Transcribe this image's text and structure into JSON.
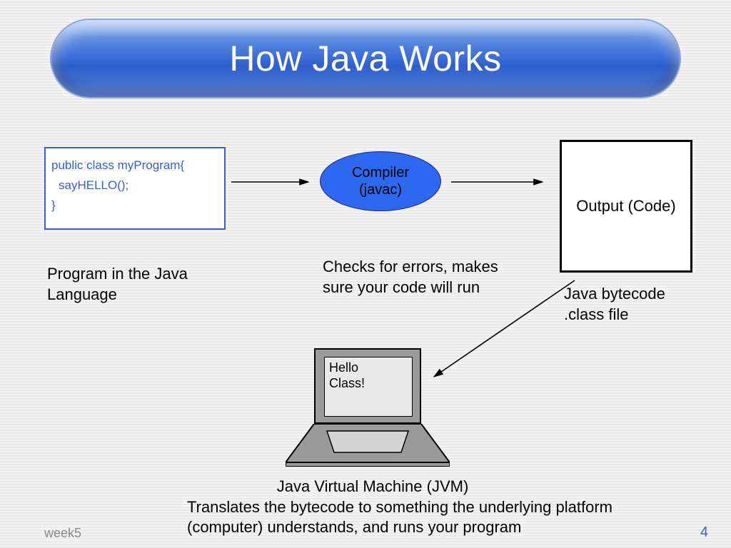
{
  "title": "How Java Works",
  "code": {
    "line1": "public class myProgram{",
    "line2": "sayHELLO();",
    "line3": "}"
  },
  "compiler": {
    "line1": "Compiler",
    "line2": "(javac)"
  },
  "output_box": "Output (Code)",
  "labels": {
    "program": "Program in the Java Language",
    "checks": "Checks for errors, makes sure your code will run",
    "bytecode": "Java bytecode .class file",
    "jvm_line1": "Java Virtual Machine (JVM)",
    "jvm_line2": "Translates the bytecode to something the underlying platform (computer) understands, and runs your program"
  },
  "laptop_screen": {
    "line1": "Hello",
    "line2": "Class!"
  },
  "footer": {
    "left": "week5",
    "page": "4"
  }
}
